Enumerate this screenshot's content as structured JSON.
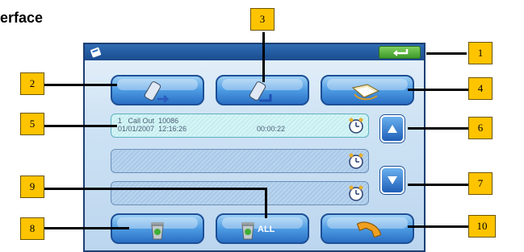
{
  "heading": "erface",
  "icons": {
    "app": "phone-book-icon",
    "back": "back-arrow-icon",
    "incoming": "incoming-call-icon",
    "outgoing": "outgoing-call-icon",
    "missed": "missed-call-icon",
    "clock": "clock-icon",
    "up": "up-arrow-icon",
    "down": "down-arrow-icon",
    "delete": "recycle-bin-icon",
    "delete_all": "recycle-bin-all-icon",
    "dial": "handset-icon"
  },
  "call_log": {
    "rows": [
      {
        "index": "1",
        "type": "Call Out",
        "number": "10086",
        "date": "01/01/2007",
        "time": "12:16:26",
        "duration": "00:00:22"
      },
      {
        "index": "",
        "type": "",
        "number": "",
        "date": "",
        "time": "",
        "duration": ""
      },
      {
        "index": "",
        "type": "",
        "number": "",
        "date": "",
        "time": "",
        "duration": ""
      }
    ]
  },
  "buttons": {
    "delete_all_label": "ALL"
  },
  "callouts": [
    "1",
    "2",
    "3",
    "4",
    "5",
    "6",
    "7",
    "8",
    "9",
    "10"
  ],
  "colors": {
    "callout": "#ffc400",
    "titlebar": "#1b4b8e",
    "back_button": "#3d9a2a",
    "button": "#2a6fc4"
  }
}
